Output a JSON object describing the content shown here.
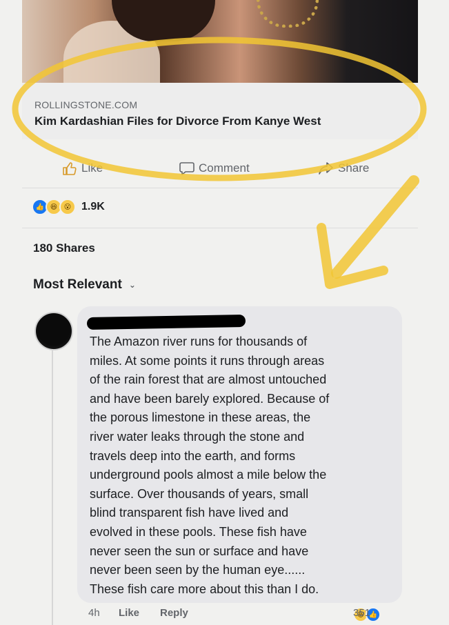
{
  "link_card": {
    "domain": "ROLLINGSTONE.COM",
    "headline": "Kim Kardashian Files for Divorce From Kanye West"
  },
  "actions": {
    "like": "Like",
    "comment": "Comment",
    "share": "Share"
  },
  "post_stats": {
    "reaction_icons": [
      "like-icon",
      "haha-icon",
      "wow-icon"
    ],
    "reaction_count": "1.9K",
    "shares": "180 Shares"
  },
  "comments_sort": {
    "label": "Most Relevant"
  },
  "comment": {
    "author_redacted": true,
    "text": "The Amazon river runs for thousands of\nmiles.  At some points it runs through areas\nof the rain forest that are almost untouched\nand have been barely explored.  Because of\nthe porous limestone in these areas, the\nriver water leaks through the stone and\ntravels deep into the earth, and forms\nunderground pools almost a mile below the\nsurface.  Over thousands of years, small\nblind transparent fish have lived and\nevolved in these pools.  These fish have\nnever seen the sun or surface and have\nnever been seen by the human eye......\nThese fish care more about this than I do.",
    "time": "4h",
    "like": "Like",
    "reply": "Reply",
    "reaction_count": "351",
    "reaction_icons": [
      "haha-icon",
      "like-icon"
    ]
  },
  "colors": {
    "annotation": "#f2c534",
    "facebook_blue": "#1877f2",
    "emoji_yellow": "#f7c94a",
    "bubble": "#e7e7ea"
  }
}
